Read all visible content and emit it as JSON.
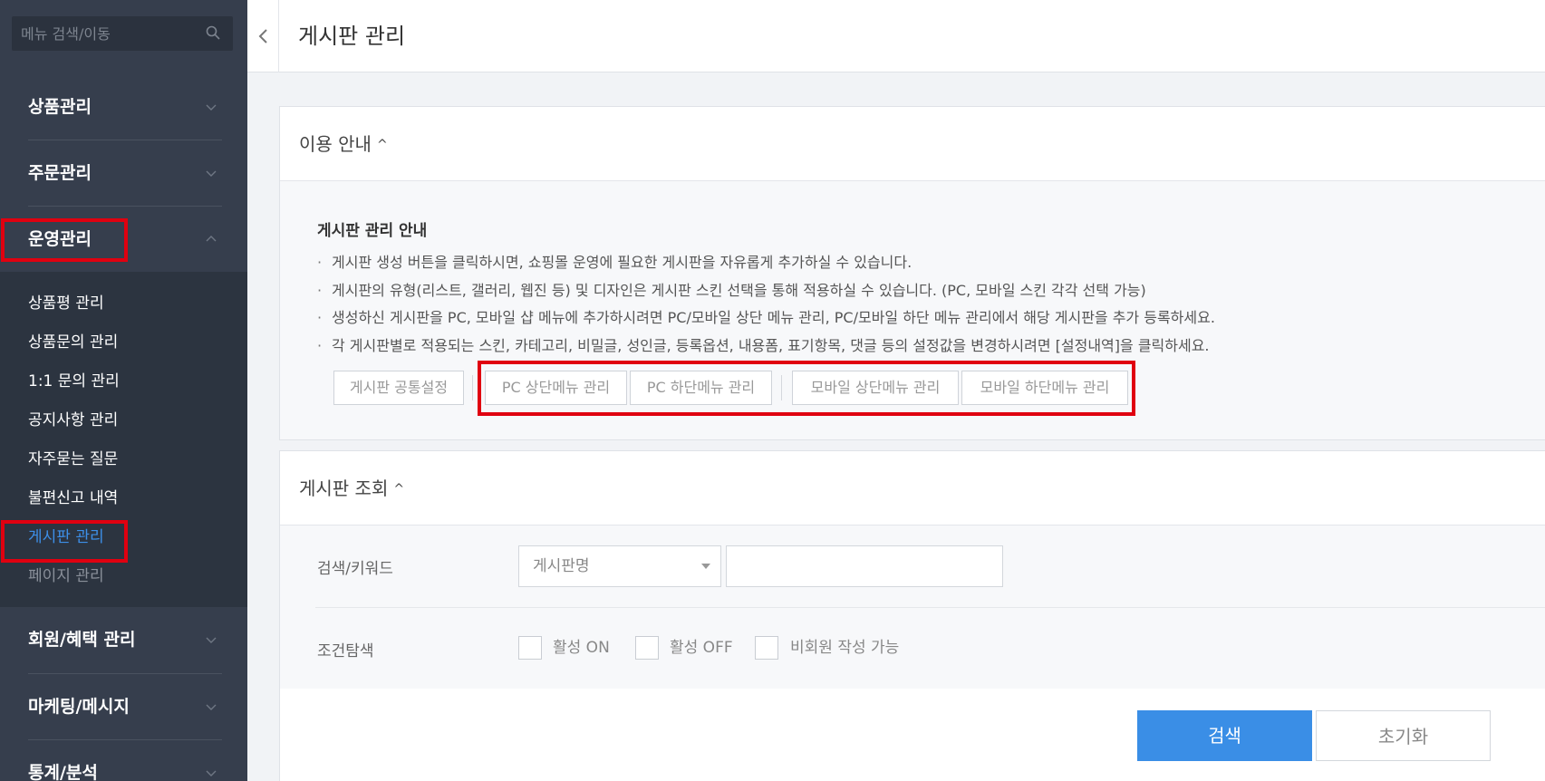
{
  "sidebar": {
    "search_placeholder": "메뉴 검색/이동",
    "menus": [
      {
        "label": "상품관리",
        "expanded": false
      },
      {
        "label": "주문관리",
        "expanded": false
      },
      {
        "label": "운영관리",
        "expanded": true
      },
      {
        "label": "회원/혜택 관리",
        "expanded": false
      },
      {
        "label": "마케팅/메시지",
        "expanded": false
      },
      {
        "label": "통계/분석",
        "expanded": false
      }
    ],
    "submenu": [
      {
        "label": "상품평 관리",
        "state": "normal"
      },
      {
        "label": "상품문의 관리",
        "state": "normal"
      },
      {
        "label": "1:1 문의 관리",
        "state": "normal"
      },
      {
        "label": "공지사항 관리",
        "state": "normal"
      },
      {
        "label": "자주묻는 질문",
        "state": "normal"
      },
      {
        "label": "불편신고 내역",
        "state": "normal"
      },
      {
        "label": "게시판 관리",
        "state": "active"
      },
      {
        "label": "페이지 관리",
        "state": "dim"
      }
    ]
  },
  "header": {
    "title": "게시판 관리"
  },
  "guide": {
    "panel_title": "이용 안내",
    "title": "게시판 관리 안내",
    "items": [
      "게시판 생성 버튼을 클릭하시면, 쇼핑몰 운영에 필요한 게시판을 자유롭게 추가하실 수 있습니다.",
      "게시판의 유형(리스트, 갤러리, 웹진 등) 및 디자인은 게시판 스킨 선택을 통해 적용하실 수 있습니다. (PC, 모바일 스킨 각각 선택 가능)",
      "생성하신 게시판을 PC, 모바일 샵 메뉴에 추가하시려면 PC/모바일 상단 메뉴 관리, PC/모바일 하단 메뉴 관리에서 해당 게시판을 추가 등록하세요.",
      "각 게시판별로 적용되는 스킨, 카테고리, 비밀글, 성인글, 등록옵션, 내용폼, 표기항목, 댓글 등의 설정값을 변경하시려면 [설정내역]을 클릭하세요."
    ],
    "buttons": {
      "common_settings": "게시판 공통설정",
      "pc_top_menu": "PC 상단메뉴 관리",
      "pc_bottom_menu": "PC 하단메뉴 관리",
      "mobile_top_menu": "모바일 상단메뉴 관리",
      "mobile_bottom_menu": "모바일 하단메뉴 관리"
    }
  },
  "search": {
    "panel_title": "게시판 조회",
    "keyword_label": "검색/키워드",
    "select_value": "게시판명",
    "keyword_value": "",
    "filter_label": "조건탐색",
    "filters": [
      {
        "label": "활성 ON",
        "checked": false
      },
      {
        "label": "활성 OFF",
        "checked": false
      },
      {
        "label": "비회원 작성 가능",
        "checked": false
      }
    ],
    "search_button": "검색",
    "reset_button": "초기화"
  },
  "colors": {
    "sidebar_bg": "#363e4d",
    "submenu_bg": "#2c3440",
    "active_link": "#3d8fe8",
    "primary": "#3a8ee6",
    "highlight": "#e00010"
  }
}
